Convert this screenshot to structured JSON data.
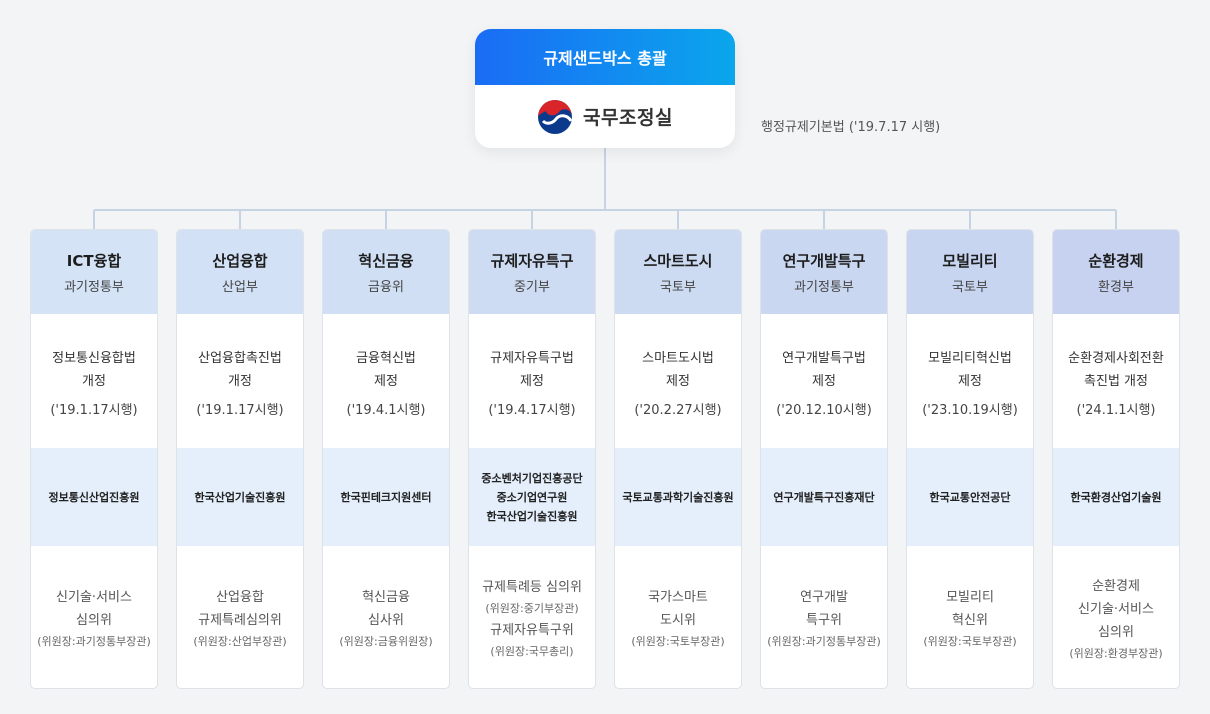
{
  "top": {
    "title": "규제샌드박스 총괄",
    "org": "국무조정실",
    "law_note": "행정규제기본법 ('19.7.17 시행)"
  },
  "colors": {
    "head_gradient_start": "#1a6cf5",
    "head_gradient_end": "#0aa6ec",
    "agency_bg": "#e4effb",
    "connector": "#c6d3e3"
  },
  "columns": [
    {
      "title": "ICT융합",
      "ministry": "과기정통부",
      "head_color": "#d4e3f6",
      "law_name": "정보통신융합법\n개정",
      "law_date": "('19.1.17시행)",
      "agency": [
        "정보통신산업진흥원"
      ],
      "committee": [
        {
          "t": "신기술·서비스",
          "s": false
        },
        {
          "t": "심의위",
          "s": false
        },
        {
          "t": "(위원장:과기정통부장관)",
          "s": true
        }
      ]
    },
    {
      "title": "산업융합",
      "ministry": "산업부",
      "head_color": "#d2e1f5",
      "law_name": "산업융합촉진법\n개정",
      "law_date": "('19.1.17시행)",
      "agency": [
        "한국산업기술진흥원"
      ],
      "committee": [
        {
          "t": "산업융합",
          "s": false
        },
        {
          "t": "규제특례심의위",
          "s": false
        },
        {
          "t": "(위원장:산업부장관)",
          "s": true
        }
      ]
    },
    {
      "title": "혁신금융",
      "ministry": "금융위",
      "head_color": "#d0dff4",
      "law_name": "금융혁신법\n제정",
      "law_date": "('19.4.1시행)",
      "agency": [
        "한국핀테크지원센터"
      ],
      "committee": [
        {
          "t": "혁신금융",
          "s": false
        },
        {
          "t": "심사위",
          "s": false
        },
        {
          "t": "(위원장:금융위원장)",
          "s": true
        }
      ]
    },
    {
      "title": "규제자유특구",
      "ministry": "중기부",
      "head_color": "#cedcf3",
      "law_name": "규제자유특구법\n제정",
      "law_date": "('19.4.17시행)",
      "agency": [
        "중소벤처기업진흥공단",
        "중소기업연구원",
        "한국산업기술진흥원"
      ],
      "committee": [
        {
          "t": "규제특례등 심의위",
          "s": false
        },
        {
          "t": "(위원장:중기부장관)",
          "s": true
        },
        {
          "t": "규제자유특구위",
          "s": false
        },
        {
          "t": "(위원장:국무총리)",
          "s": true
        }
      ]
    },
    {
      "title": "스마트도시",
      "ministry": "국토부",
      "head_color": "#ccdaf2",
      "law_name": "스마트도시법\n제정",
      "law_date": "('20.2.27시행)",
      "agency": [
        "국토교통과학기술진흥원"
      ],
      "committee": [
        {
          "t": "국가스마트",
          "s": false
        },
        {
          "t": "도시위",
          "s": false
        },
        {
          "t": "(위원장:국토부장관)",
          "s": true
        }
      ]
    },
    {
      "title": "연구개발특구",
      "ministry": "과기정통부",
      "head_color": "#cad7f1",
      "law_name": "연구개발특구법\n제정",
      "law_date": "('20.12.10시행)",
      "agency": [
        "연구개발특구진흥재단"
      ],
      "committee": [
        {
          "t": "연구개발",
          "s": false
        },
        {
          "t": "특구위",
          "s": false
        },
        {
          "t": "(위원장:과기정통부장관)",
          "s": true
        }
      ]
    },
    {
      "title": "모빌리티",
      "ministry": "국토부",
      "head_color": "#c8d5f0",
      "law_name": "모빌리티혁신법\n제정",
      "law_date": "('23.10.19시행)",
      "agency": [
        "한국교통안전공단"
      ],
      "committee": [
        {
          "t": "모빌리티",
          "s": false
        },
        {
          "t": "혁신위",
          "s": false
        },
        {
          "t": "(위원장:국토부장관)",
          "s": true
        }
      ]
    },
    {
      "title": "순환경제",
      "ministry": "환경부",
      "head_color": "#c6d2ef",
      "law_name": "순환경제사회전환\n촉진법 개정",
      "law_date": "('24.1.1시행)",
      "agency": [
        "한국환경산업기술원"
      ],
      "committee": [
        {
          "t": "순환경제",
          "s": false
        },
        {
          "t": "신기술·서비스",
          "s": false
        },
        {
          "t": "심의위",
          "s": false
        },
        {
          "t": "(위원장:환경부장관)",
          "s": true
        }
      ]
    }
  ]
}
